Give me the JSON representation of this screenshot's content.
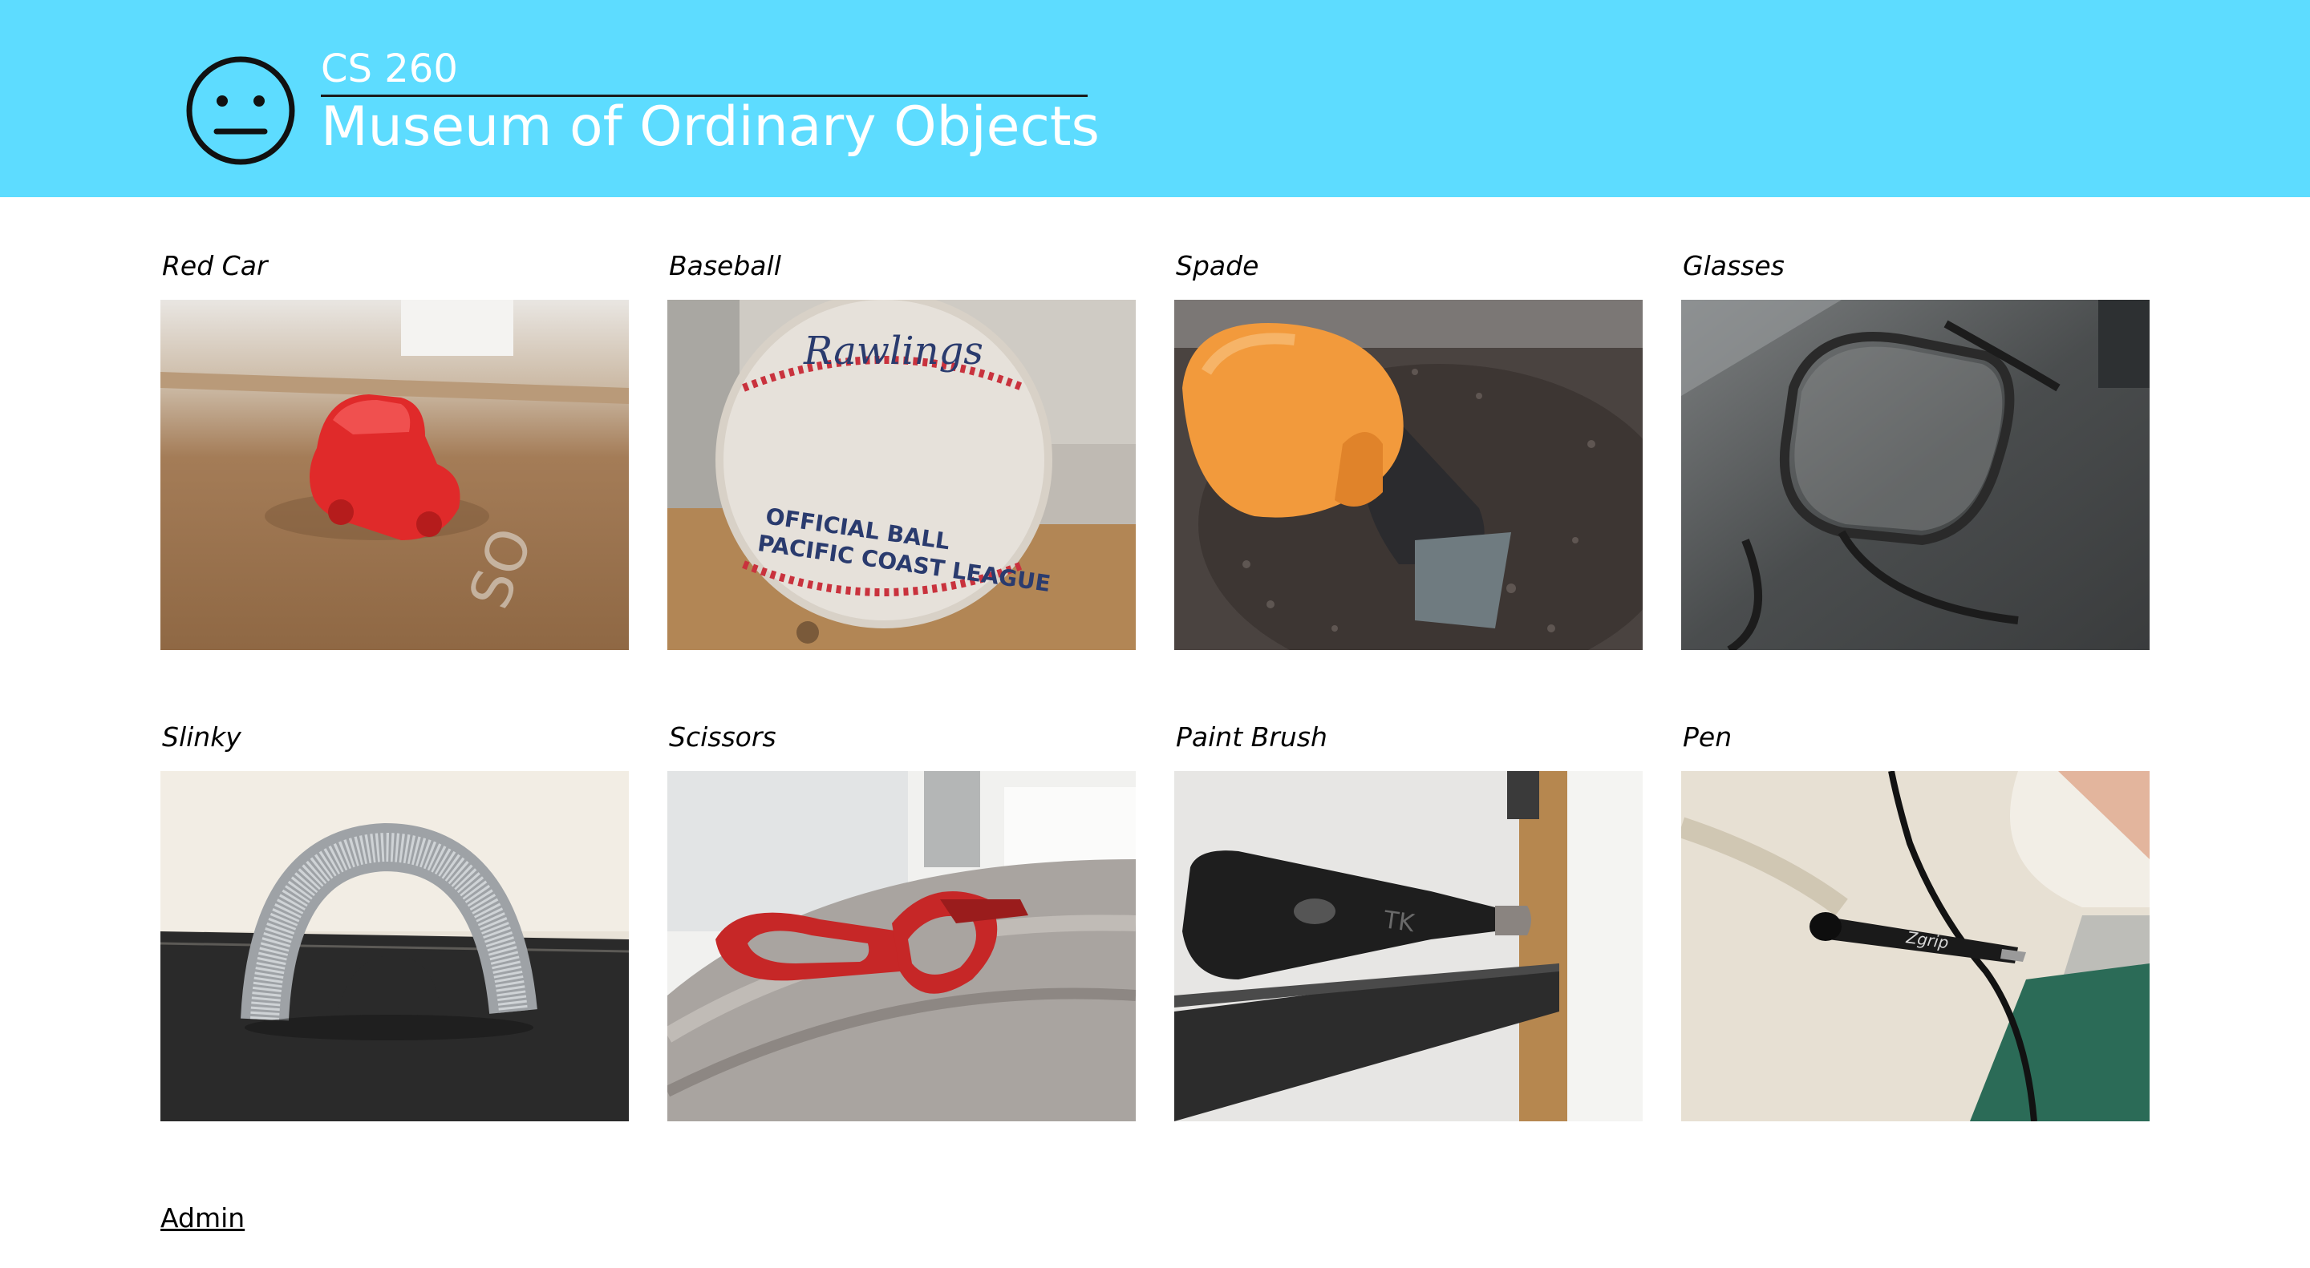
{
  "header": {
    "course": "CS 260",
    "title": "Museum of Ordinary Objects",
    "logo_icon": "neutral-face-icon",
    "background_color": "#5ddcff"
  },
  "items": [
    {
      "title": "Red Car",
      "photo": "red toy car on cardboard box"
    },
    {
      "title": "Baseball",
      "photo": "Rawlings official Pacific Coast League baseball"
    },
    {
      "title": "Spade",
      "photo": "orange handled garden spade in soil"
    },
    {
      "title": "Glasses",
      "photo": "eyeglasses on dark countertop"
    },
    {
      "title": "Slinky",
      "photo": "metal slinky on dark table"
    },
    {
      "title": "Scissors",
      "photo": "red handled scissors on grey blanket"
    },
    {
      "title": "Paint Brush",
      "photo": "black paint brush on shelf"
    },
    {
      "title": "Pen",
      "photo": "black pen with clip"
    }
  ],
  "footer": {
    "admin_label": "Admin"
  }
}
